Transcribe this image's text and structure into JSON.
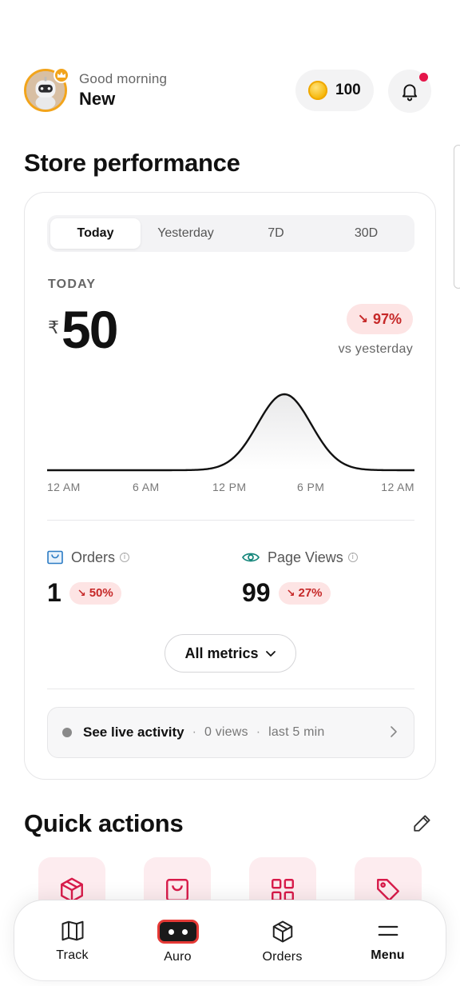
{
  "header": {
    "greeting": "Good morning",
    "username": "New",
    "coins": "100",
    "has_notification": true,
    "accent_color": "#f2a41b",
    "notification_color": "#e5164a"
  },
  "store_performance": {
    "title": "Store performance",
    "tabs": [
      {
        "label": "Today",
        "active": true
      },
      {
        "label": "Yesterday",
        "active": false
      },
      {
        "label": "7D",
        "active": false
      },
      {
        "label": "30D",
        "active": false
      }
    ],
    "period_label": "TODAY",
    "currency": "₹",
    "amount": "50",
    "delta": "97%",
    "delta_direction": "down",
    "comparison": "vs yesterday",
    "chart_data": {
      "type": "area",
      "x": [
        "12 AM",
        "6 AM",
        "12 PM",
        "6 PM",
        "12 AM"
      ],
      "series": [
        {
          "values": [
            0,
            0,
            0,
            1,
            0,
            0
          ]
        }
      ],
      "x_hours": [
        0,
        6,
        12,
        15.5,
        19,
        24
      ],
      "grid": false,
      "line_color": "#111111"
    },
    "metrics": [
      {
        "label": "Orders",
        "value": "1",
        "delta": "50%",
        "delta_direction": "down",
        "icon": "shopping-bag-icon"
      },
      {
        "label": "Page Views",
        "value": "99",
        "delta": "27%",
        "delta_direction": "down",
        "icon": "eye-icon"
      }
    ],
    "all_metrics_label": "All metrics",
    "live": {
      "title": "See live activity",
      "views": "0 views",
      "window": "last 5 min"
    }
  },
  "quick_actions": {
    "title": "Quick actions",
    "tiles": [
      {
        "icon": "package-icon"
      },
      {
        "icon": "shopping-bag-icon"
      },
      {
        "icon": "grid-icon"
      },
      {
        "icon": "tag-icon"
      }
    ],
    "tile_color": "#fdecef",
    "icon_color": "#d81b4a"
  },
  "bottom_nav": {
    "items": [
      {
        "label": "Track",
        "icon": "map-icon"
      },
      {
        "label": "Auro",
        "icon": "auro-robot-icon"
      },
      {
        "label": "Orders",
        "icon": "package-icon"
      },
      {
        "label": "Menu",
        "icon": "menu-icon"
      }
    ]
  },
  "colors": {
    "negative_bg": "#fde4e4",
    "negative_text": "#c62828"
  }
}
